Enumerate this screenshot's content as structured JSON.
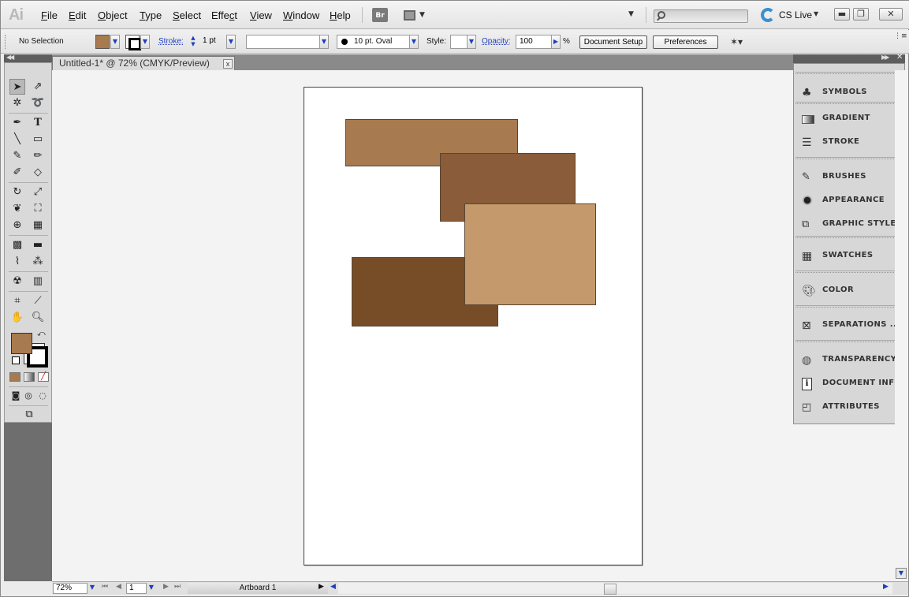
{
  "app": {
    "logo": "Ai",
    "menu": [
      "File",
      "Edit",
      "Object",
      "Type",
      "Select",
      "Effect",
      "View",
      "Window",
      "Help"
    ],
    "menu_underline": [
      "F",
      "E",
      "O",
      "T",
      "S",
      "c",
      "V",
      "W",
      "H"
    ],
    "bridge_label": "Br",
    "search_placeholder": "",
    "cs_live_label": "CS Live"
  },
  "control_bar": {
    "selection_label": "No Selection",
    "fill_color": "#a87a4f",
    "stroke_label": "Stroke:",
    "stroke_weight": "1 pt",
    "variable_width": "",
    "brush_label": "10 pt. Oval",
    "style_label": "Style:",
    "opacity_label": "Opacity:",
    "opacity_value": "100",
    "opacity_unit": "%",
    "document_setup_label": "Document Setup",
    "preferences_label": "Preferences"
  },
  "document": {
    "tab_title": "Untitled-1* @ 72% (CMYK/Preview)",
    "tab_close": "x",
    "shapes": [
      {
        "name": "rect-tan",
        "color": "#a87a4f"
      },
      {
        "name": "rect-brown",
        "color": "#8a5c3a"
      },
      {
        "name": "rect-dark-brown",
        "color": "#774d28"
      },
      {
        "name": "rect-light-tan",
        "color": "#c49a6c"
      }
    ]
  },
  "tools": {
    "fill_color": "#a87a4f",
    "stroke_color": "#000000"
  },
  "panels": {
    "items": [
      {
        "label": "SYMBOLS",
        "icon": "symbols-icon"
      },
      {
        "label": "GRADIENT",
        "icon": "gradient-icon"
      },
      {
        "label": "STROKE",
        "icon": "stroke-icon"
      },
      {
        "label": "BRUSHES",
        "icon": "brushes-icon"
      },
      {
        "label": "APPEARANCE",
        "icon": "appearance-icon"
      },
      {
        "label": "GRAPHIC STYLES",
        "icon": "graphic-styles-icon"
      },
      {
        "label": "SWATCHES",
        "icon": "swatches-icon"
      },
      {
        "label": "COLOR",
        "icon": "color-icon"
      },
      {
        "label": "SEPARATIONS ...",
        "icon": "separations-icon"
      },
      {
        "label": "TRANSPARENCY",
        "icon": "transparency-icon"
      },
      {
        "label": "DOCUMENT INFO",
        "icon": "document-info-icon"
      },
      {
        "label": "ATTRIBUTES",
        "icon": "attributes-icon"
      }
    ]
  },
  "status_bar": {
    "zoom": "72%",
    "artboard_number": "1",
    "artboard_label": "Artboard 1"
  }
}
